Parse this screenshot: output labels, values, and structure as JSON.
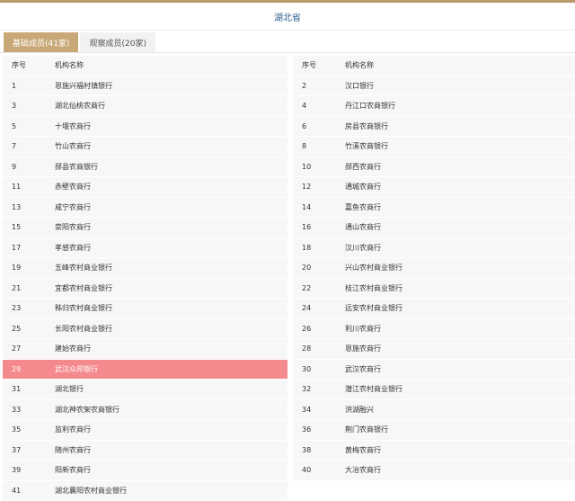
{
  "header": {
    "province": "湖北省"
  },
  "tabs": [
    {
      "label": "基础成员(41家)",
      "active": true
    },
    {
      "label": "观察成员(20家)",
      "active": false
    }
  ],
  "table": {
    "columns": [
      "序号",
      "机构名称"
    ],
    "left": [
      [
        "1",
        "恩施兴福村镇银行"
      ],
      [
        "3",
        "湖北仙桃农商行"
      ],
      [
        "5",
        "十堰农商行"
      ],
      [
        "7",
        "竹山农商行"
      ],
      [
        "9",
        "郧县农商银行"
      ],
      [
        "11",
        "赤壁农商行"
      ],
      [
        "13",
        "咸宁农商行"
      ],
      [
        "15",
        "崇阳农商行"
      ],
      [
        "17",
        "孝感农商行"
      ],
      [
        "19",
        "五峰农村商业银行"
      ],
      [
        "21",
        "宜都农村商业银行"
      ],
      [
        "23",
        "秭归农村商业银行"
      ],
      [
        "25",
        "长阳农村商业银行"
      ],
      [
        "27",
        "建始农商行"
      ],
      [
        "29",
        "武汉众邦银行"
      ],
      [
        "31",
        "湖北银行"
      ],
      [
        "33",
        "湖北神农架农商银行"
      ],
      [
        "35",
        "监利农商行"
      ],
      [
        "37",
        "随州农商行"
      ],
      [
        "39",
        "阳新农商行"
      ],
      [
        "41",
        "湖北襄阳农村商业银行"
      ]
    ],
    "right": [
      [
        "2",
        "汉口银行"
      ],
      [
        "4",
        "丹江口农商银行"
      ],
      [
        "6",
        "房县农商银行"
      ],
      [
        "8",
        "竹溪农商银行"
      ],
      [
        "10",
        "郧西农商行"
      ],
      [
        "12",
        "通城农商行"
      ],
      [
        "14",
        "嘉鱼农商行"
      ],
      [
        "16",
        "通山农商行"
      ],
      [
        "18",
        "汉川农商行"
      ],
      [
        "20",
        "兴山农村商业银行"
      ],
      [
        "22",
        "枝江农村商业银行"
      ],
      [
        "24",
        "远安农村商业银行"
      ],
      [
        "26",
        "利川农商行"
      ],
      [
        "28",
        "恩施农商行"
      ],
      [
        "30",
        "武汉农商行"
      ],
      [
        "32",
        "潜江农村商业银行"
      ],
      [
        "34",
        "洪湖融兴"
      ],
      [
        "36",
        "荆门农商银行"
      ],
      [
        "38",
        "黄梅农商行"
      ],
      [
        "40",
        "大冶农商行"
      ]
    ],
    "highlight_row": "29",
    "highlight_color": "#f48a8d"
  }
}
